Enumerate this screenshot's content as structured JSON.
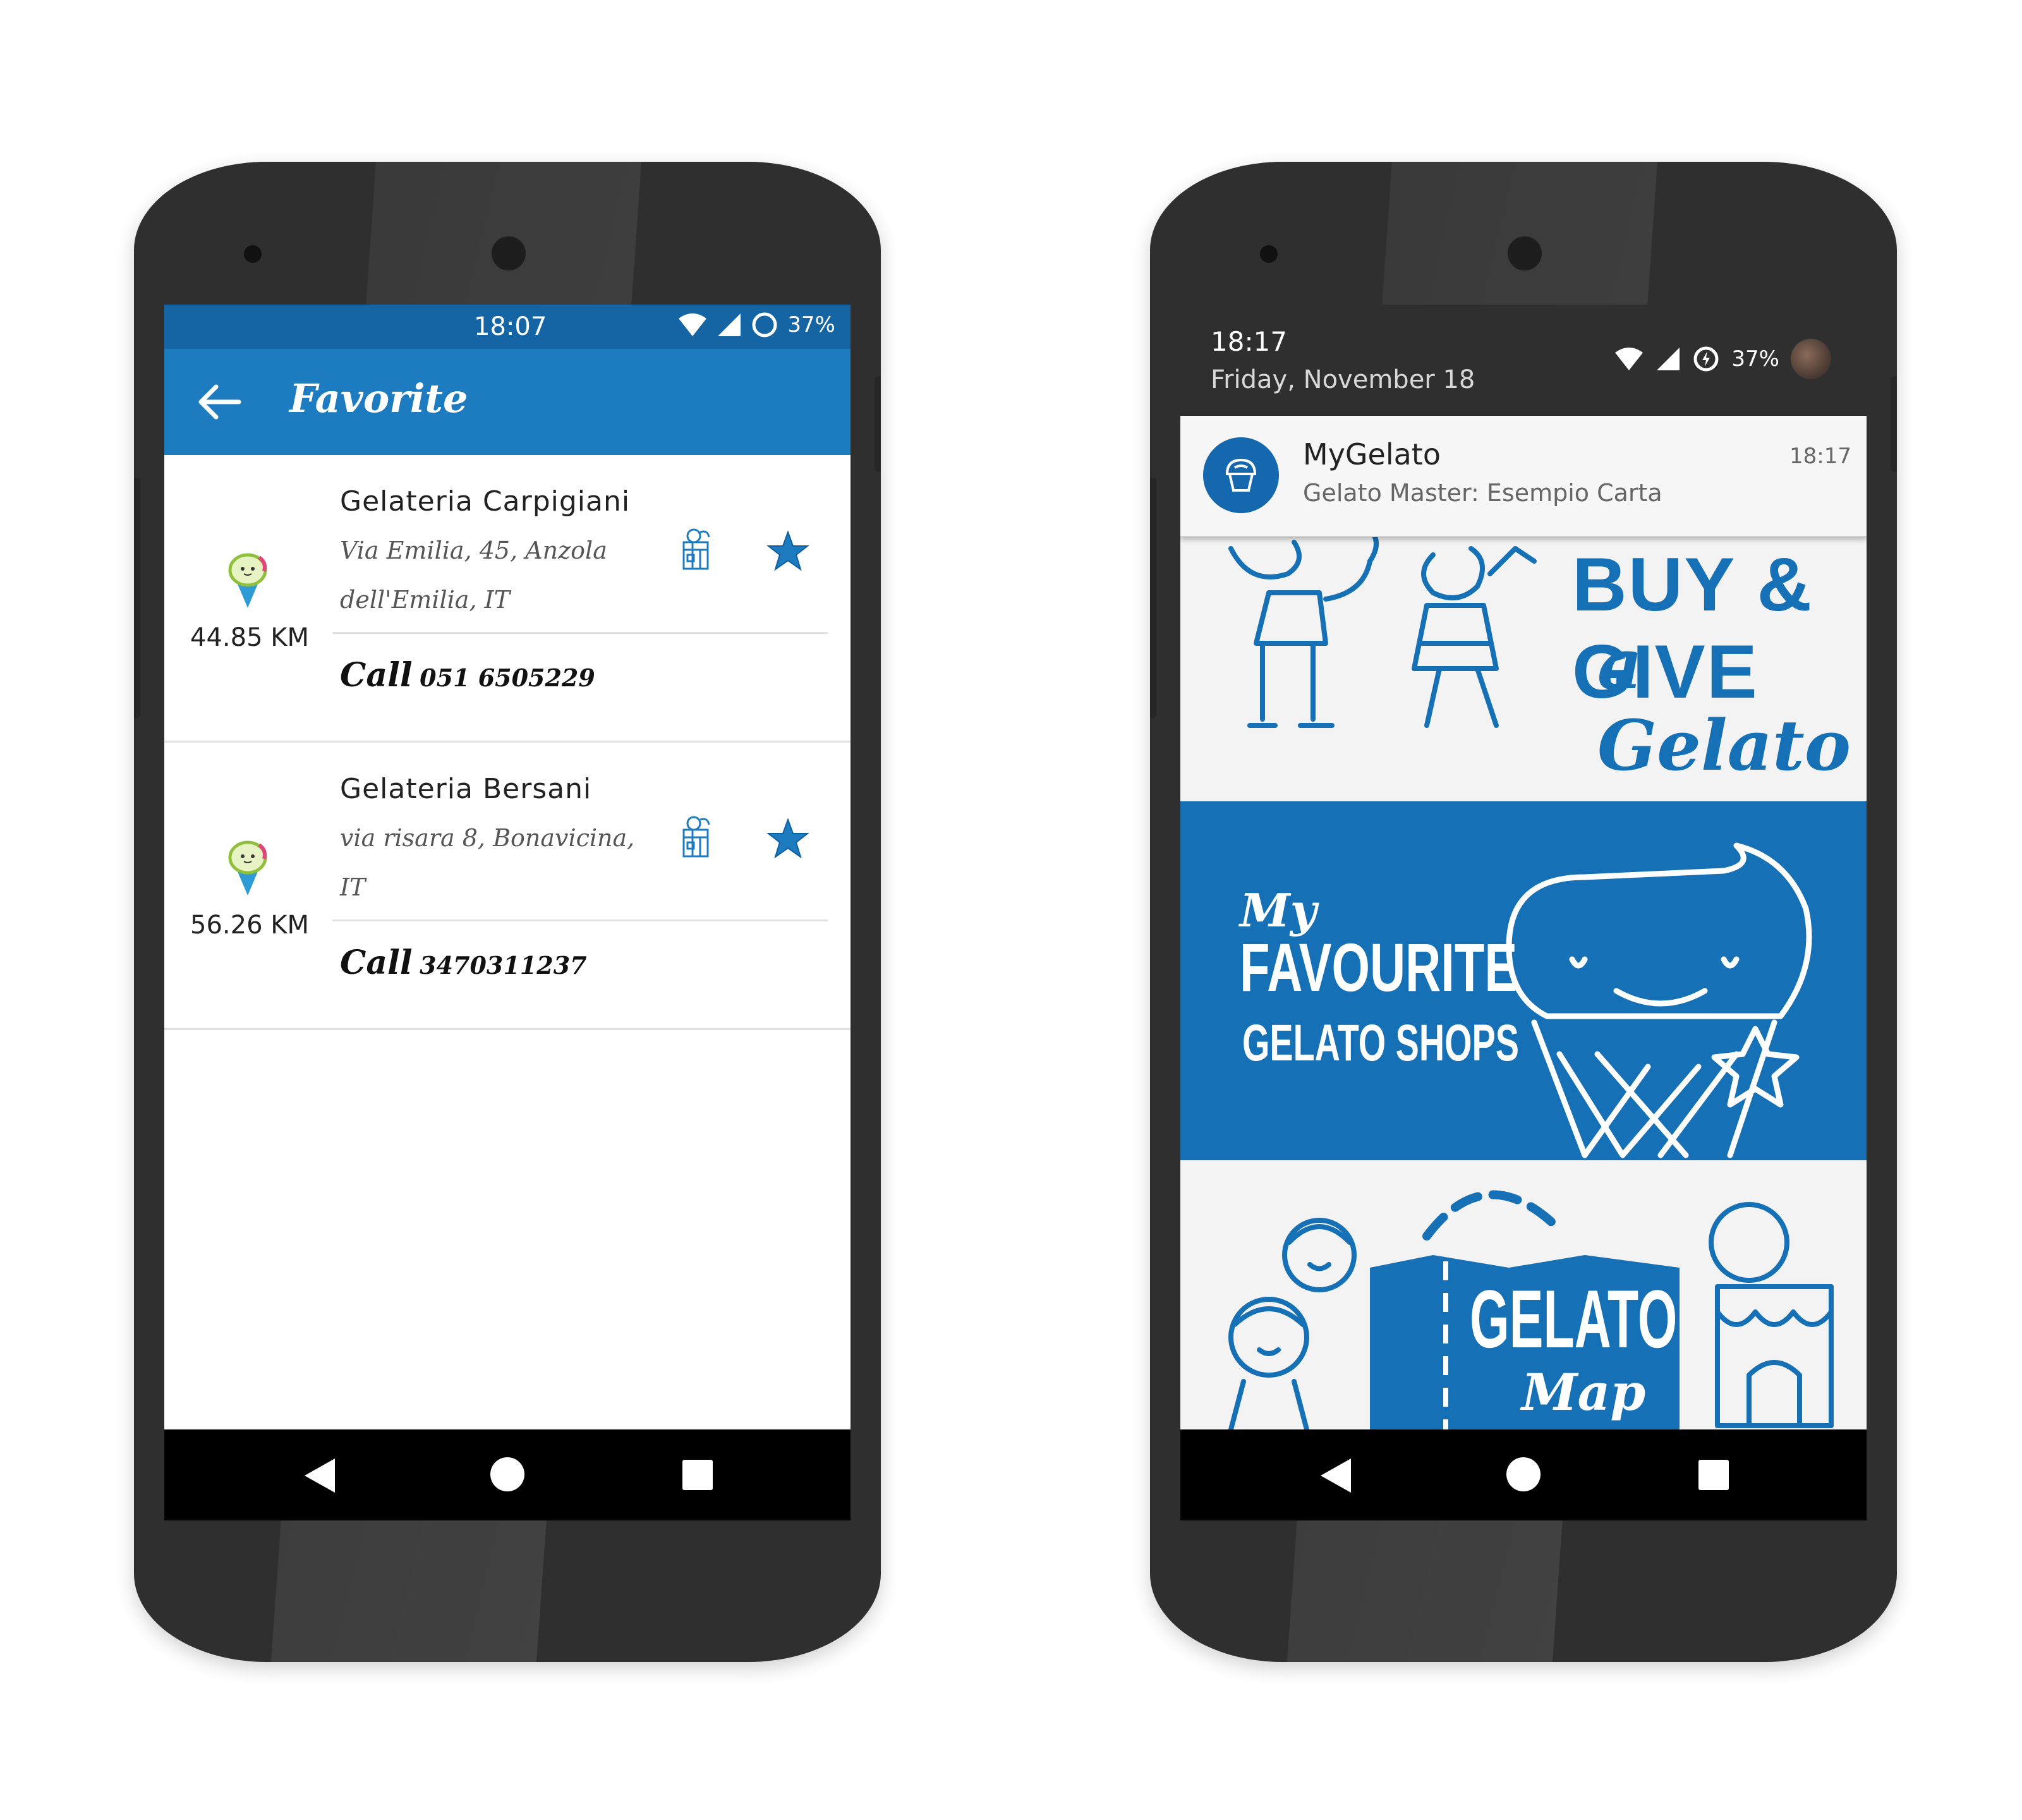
{
  "left_phone": {
    "status": {
      "time": "18:07",
      "battery": "37%"
    },
    "appbar": {
      "title": "Favorite"
    },
    "shops": [
      {
        "name": "Gelateria Carpigiani",
        "address": "Via Emilia, 45, Anzola dell'Emilia, IT",
        "distance": "44.85 KM",
        "call_label": "Call",
        "phone": "051 6505229"
      },
      {
        "name": "Gelateria Bersani",
        "address": "via risara 8, Bonavicina, IT",
        "distance": "56.26 KM",
        "call_label": "Call",
        "phone": "3470311237"
      }
    ]
  },
  "right_phone": {
    "header": {
      "time": "18:17",
      "date": "Friday, November 18",
      "battery": "37%"
    },
    "notification": {
      "app": "MyGelato",
      "message": "Gelato Master: Esempio Carta",
      "time": "18:17"
    },
    "banners": {
      "buy_give": {
        "line1": "BUY & GIVE",
        "line2": "a Gelato"
      },
      "favourite": {
        "line1": "My",
        "line2": "FAVOURITE",
        "line3": "GELATO SHOPS"
      },
      "map": {
        "line1": "GELATO",
        "line2": "Map"
      }
    }
  },
  "colors": {
    "status_bar": "#1565a5",
    "app_bar": "#1d7bc0",
    "accent_blue": "#1570b6",
    "phone_body": "#2f2f2f"
  }
}
